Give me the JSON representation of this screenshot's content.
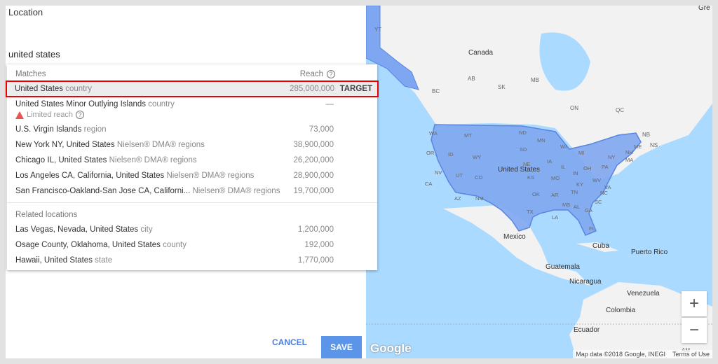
{
  "panel": {
    "label": "Location",
    "query": "united states"
  },
  "dropdown": {
    "matches_header": "Matches",
    "reach_header": "Reach",
    "help_icon": "?",
    "matches": [
      {
        "name": "United States",
        "type": "country",
        "reach": "285,000,000",
        "action": "TARGET"
      },
      {
        "name": "United States Minor Outlying Islands",
        "type": "country",
        "reach": "—",
        "warning": "Limited reach"
      },
      {
        "name": "U.S. Virgin Islands",
        "type": "region",
        "reach": "73,000"
      },
      {
        "name": "New York NY, United States",
        "type": "Nielsen® DMA® regions",
        "reach": "38,900,000"
      },
      {
        "name": "Chicago IL, United States",
        "type": "Nielsen® DMA® regions",
        "reach": "26,200,000"
      },
      {
        "name": "Los Angeles CA, California, United States",
        "type": "Nielsen® DMA® regions",
        "reach": "28,900,000"
      },
      {
        "name": "San Francisco-Oakland-San Jose CA, Californi...",
        "type": "Nielsen® DMA® regions",
        "reach": "19,700,000"
      }
    ],
    "related_header": "Related locations",
    "related": [
      {
        "name": "Las Vegas, Nevada, United States",
        "type": "city",
        "reach": "1,200,000"
      },
      {
        "name": "Osage County, Oklahoma, United States",
        "type": "county",
        "reach": "192,000"
      },
      {
        "name": "Hawaii, United States",
        "type": "state",
        "reach": "1,770,000"
      }
    ]
  },
  "buttons": {
    "cancel": "CANCEL",
    "save": "SAVE"
  },
  "map": {
    "highlight_color": "#7fa6f0",
    "ocean_color": "#aadaff",
    "land_color": "#f2f2f2",
    "labels": {
      "yt": "YT",
      "canada": "Canada",
      "ab": "AB",
      "bc": "BC",
      "sk": "SK",
      "mb": "MB",
      "on": "ON",
      "qc": "QC",
      "nb": "NB",
      "ns": "NS",
      "us": "United States",
      "mexico": "Mexico",
      "cuba": "Cuba",
      "pr": "Puerto Rico",
      "guatemala": "Guatemala",
      "nicaragua": "Nicaragua",
      "venezuela": "Venezuela",
      "colombia": "Colombia",
      "ecuador": "Ecuador",
      "am": "AM",
      "pa": "PA",
      "gre": "Gre"
    },
    "states": [
      "WA",
      "MT",
      "ND",
      "MN",
      "OR",
      "ID",
      "SD",
      "WI",
      "MI",
      "WY",
      "NY",
      "NH",
      "ME",
      "MA",
      "NV",
      "UT",
      "NE",
      "IA",
      "IL",
      "OH",
      "PA",
      "CA",
      "CO",
      "KS",
      "MO",
      "IN",
      "KY",
      "WV",
      "VA",
      "AZ",
      "NM",
      "OK",
      "AR",
      "TN",
      "NC",
      "SC",
      "TX",
      "MS",
      "AL",
      "GA",
      "LA",
      "FL"
    ],
    "zoom_in": "+",
    "zoom_out": "−",
    "logo": "Google",
    "attribution": "Map data ©2018 Google, INEGI",
    "terms": "Terms of Use"
  }
}
